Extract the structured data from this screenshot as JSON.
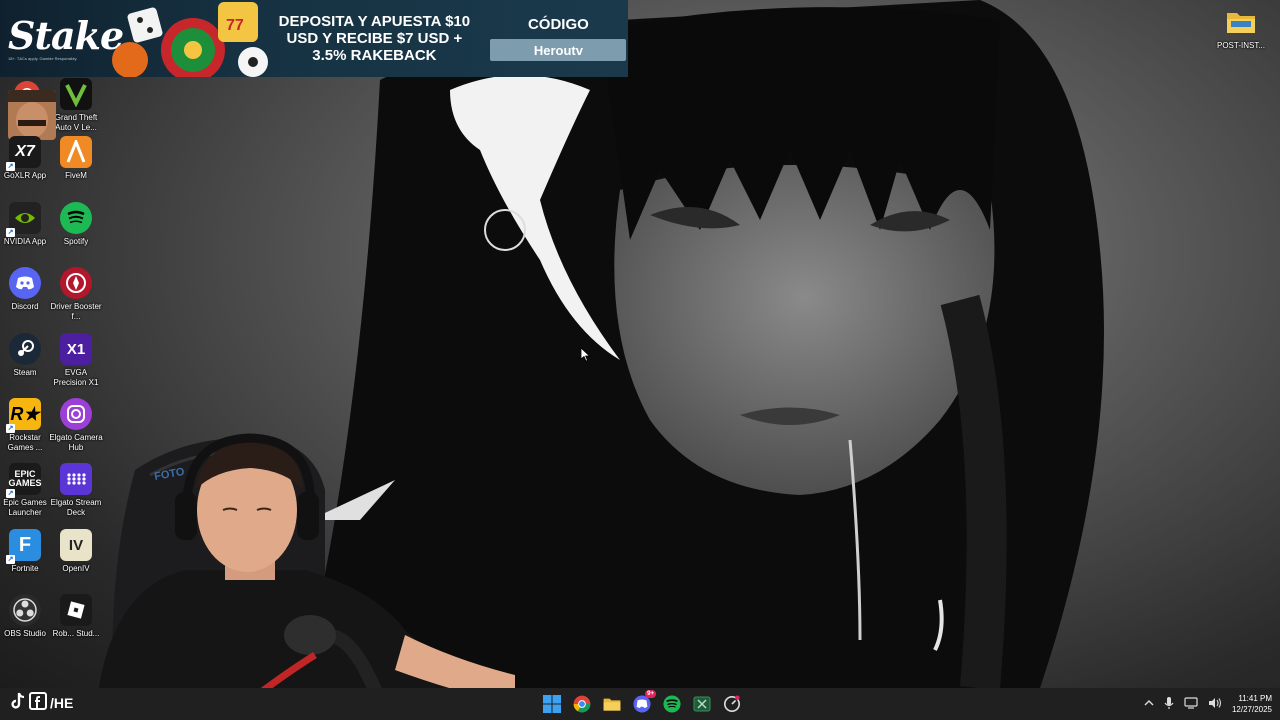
{
  "banner": {
    "brand": "Stake",
    "fine_print": "18+. T&Cs apply. Gamble Responsibly.",
    "promo": "DEPOSITA Y APUESTA $10 USD Y RECIBE $7 USD + 3.5% RAKEBACK",
    "code_label": "CÓDIGO",
    "code_value": "Heroutv"
  },
  "desktop_icons": [
    {
      "label": "Grand Theft Auto V Le...",
      "icon": "gtav-icon"
    },
    {
      "label": "GoXLR App",
      "icon": "goxlr-icon"
    },
    {
      "label": "FiveM",
      "icon": "fivem-icon"
    },
    {
      "label": "NVIDIA App",
      "icon": "nvidia-icon"
    },
    {
      "label": "Spotify",
      "icon": "spotify-icon"
    },
    {
      "label": "Discord",
      "icon": "discord-icon"
    },
    {
      "label": "Driver Booster f...",
      "icon": "driver-booster-icon"
    },
    {
      "label": "Steam",
      "icon": "steam-icon"
    },
    {
      "label": "EVGA Precision X1",
      "icon": "evga-icon"
    },
    {
      "label": "Rockstar Games ...",
      "icon": "rockstar-icon"
    },
    {
      "label": "Elgato Camera Hub",
      "icon": "elgato-camera-icon"
    },
    {
      "label": "Epic Games Launcher",
      "icon": "epic-games-icon"
    },
    {
      "label": "Elgato Stream Deck",
      "icon": "elgato-streamdeck-icon"
    },
    {
      "label": "Fortnite",
      "icon": "fortnite-icon"
    },
    {
      "label": "OpenIV",
      "icon": "openiv-icon"
    },
    {
      "label": "OBS Studio",
      "icon": "obs-icon"
    },
    {
      "label": "Rob... Stud...",
      "icon": "roblox-studio-icon"
    },
    {
      "label": "POST-INST...",
      "icon": "folder-icon"
    }
  ],
  "overlay": {
    "goxlr_badge": "X7"
  },
  "taskbar": {
    "social_text": "/HE",
    "discord_badge": "9+",
    "time": "11:41 PM",
    "date": "12/27/2025"
  },
  "colors": {
    "taskbar_bg": "#202020",
    "banner_bg": "#163242",
    "code_box": "#7d9cad",
    "spotify": "#1db954",
    "discord": "#5865f2"
  }
}
